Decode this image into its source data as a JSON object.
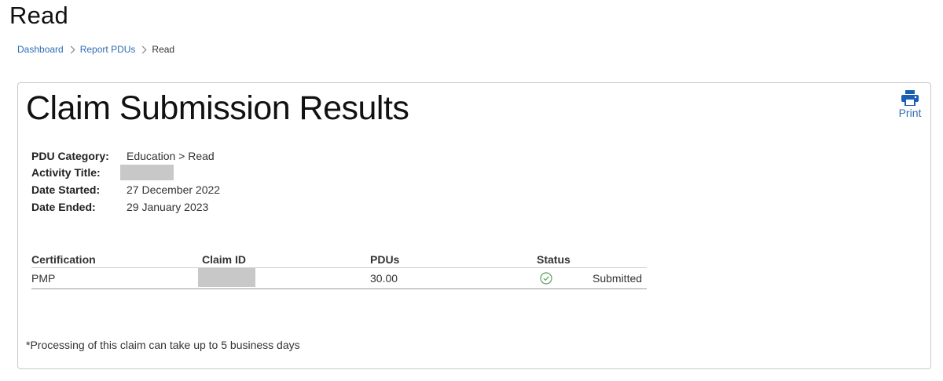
{
  "page": {
    "title": "Read"
  },
  "breadcrumb": {
    "items": [
      "Dashboard",
      "Report PDUs",
      "Read"
    ]
  },
  "card": {
    "title": "Claim Submission Results",
    "print_label": "Print",
    "details": {
      "category_label": "PDU Category:",
      "category_value": "Education > Read",
      "activity_label": "Activity Title:",
      "started_label": "Date Started:",
      "started_value": "27 December 2022",
      "ended_label": "Date Ended:",
      "ended_value": "29 January 2023"
    },
    "results": {
      "headers": [
        "Certification",
        "Claim ID",
        "PDUs",
        "Status"
      ],
      "rows": [
        {
          "certification": "PMP",
          "pdus": "30.00",
          "status": "Submitted"
        }
      ]
    },
    "footnote": "*Processing of this claim can take up to 5 business days"
  },
  "colors": {
    "link": "#2f6db3",
    "success": "#5aa05a",
    "redacted": "#c8c8c8"
  },
  "icons": {
    "print": "printer-icon",
    "status": "check-circle-icon"
  }
}
